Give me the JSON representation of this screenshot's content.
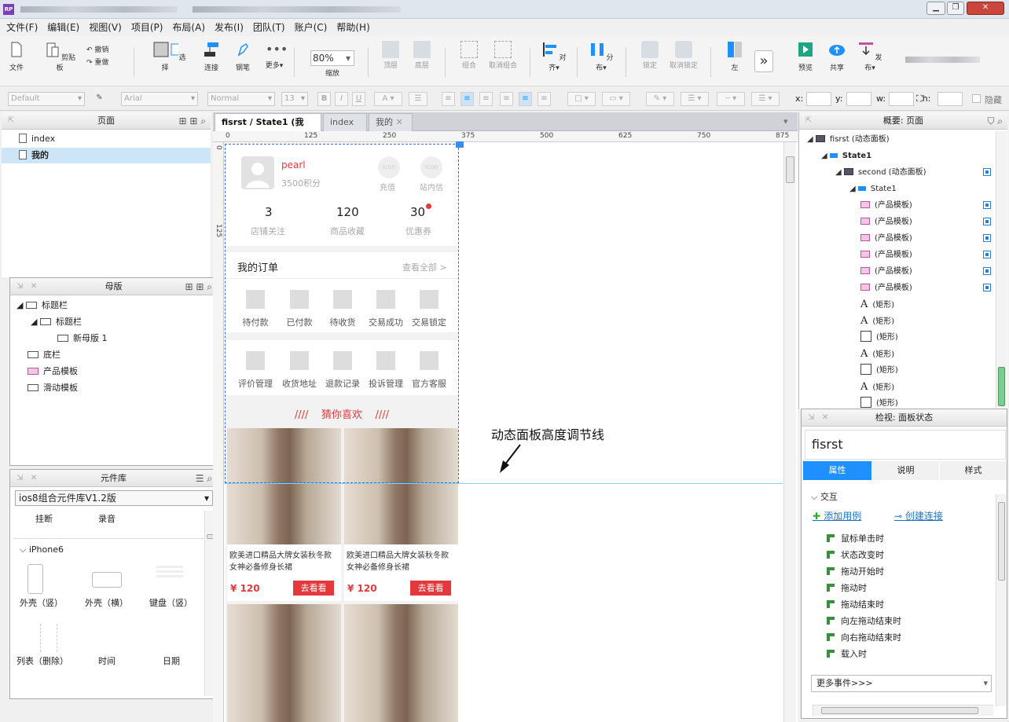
{
  "menu": [
    "文件(F)",
    "编辑(E)",
    "视图(V)",
    "项目(P)",
    "布局(A)",
    "发布(I)",
    "团队(T)",
    "账户(C)",
    "帮助(H)"
  ],
  "toolbar": {
    "file": "文件",
    "clipboard": "剪贴板",
    "undo": "撤销",
    "redo": "重做",
    "select": "选择",
    "connect": "连接",
    "pen": "钢笔",
    "more": "更多▾",
    "zoom": "80%",
    "zoom_label": "缩放",
    "top": "顶层",
    "bottom": "底层",
    "group": "组合",
    "ungroup": "取消组合",
    "align": "对齐▾",
    "distribute": "分布▾",
    "lock": "锁定",
    "unlock": "取消锁定",
    "left": "左",
    "preview": "预览",
    "share": "共享",
    "publish": "发布▾"
  },
  "fmt": {
    "style": "Default",
    "font": "Arial",
    "weight": "Normal",
    "size": "13",
    "x": "x:",
    "y": "y:",
    "w": "w:",
    "h": "h:",
    "hide": "隐藏"
  },
  "pages": {
    "title": "页面",
    "items": [
      "index",
      "我的"
    ]
  },
  "masters": {
    "title": "母版",
    "items": [
      "标题栏",
      "标题栏",
      "新母版 1",
      "底栏",
      "产品模板",
      "滑动模板"
    ]
  },
  "library": {
    "title": "元件库",
    "selected": "ios8组合元件库V1.2版",
    "top_items": [
      "挂断",
      "录音"
    ],
    "group": "iPhone6",
    "items": [
      "外壳（竖）",
      "外壳（横）",
      "键盘（竖）",
      "列表（删除）",
      "时间",
      "日期"
    ]
  },
  "tabs": [
    "fisrst / State1 (我的)",
    "index",
    "我的"
  ],
  "ruler": {
    "h": [
      "0",
      "125",
      "250",
      "375",
      "500",
      "625",
      "750",
      "875"
    ],
    "v": [
      "0",
      "125"
    ]
  },
  "phone": {
    "user": "pearl",
    "points": "3500积分",
    "icon_txt": "icon",
    "top_actions": [
      "充值",
      "站内信"
    ],
    "stats": [
      {
        "n": "3",
        "l": "店铺关注"
      },
      {
        "n": "120",
        "l": "商品收藏"
      },
      {
        "n": "30",
        "l": "优惠券"
      }
    ],
    "orders_title": "我的订单",
    "view_all": "查看全部 >",
    "order_items": [
      "待付款",
      "已付款",
      "待收货",
      "交易成功",
      "交易锁定"
    ],
    "service_items": [
      "评价管理",
      "收货地址",
      "退款记录",
      "投诉管理",
      "官方客服"
    ],
    "guess_prefix": "////",
    "guess": "猜你喜欢",
    "guess_suffix": "////",
    "product_desc": "欧美进口精品大牌女装秋冬款女神必备修身长裙",
    "price": "¥ 120",
    "buy": "去看看"
  },
  "annotation": "动态面板高度调节线",
  "outline": {
    "title": "概要: 页面",
    "rows": [
      {
        "t": "fisrst (动态面板)",
        "ic": "dp"
      },
      {
        "t": "State1",
        "ic": "st"
      },
      {
        "t": "second (动态面板)",
        "ic": "dp"
      },
      {
        "t": "State1",
        "ic": "st"
      },
      {
        "t": "(产品模板)",
        "ic": "pink"
      },
      {
        "t": "(产品模板)",
        "ic": "pink"
      },
      {
        "t": "(产品模板)",
        "ic": "pink"
      },
      {
        "t": "(产品模板)",
        "ic": "pink"
      },
      {
        "t": "(产品模板)",
        "ic": "pink"
      },
      {
        "t": "(产品模板)",
        "ic": "pink"
      },
      {
        "t": "(矩形)",
        "ic": "A"
      },
      {
        "t": "(矩形)",
        "ic": "A"
      },
      {
        "t": "(矩形)",
        "ic": "box"
      },
      {
        "t": "(矩形)",
        "ic": "A"
      },
      {
        "t": "(矩形)",
        "ic": "box"
      },
      {
        "t": "(矩形)",
        "ic": "A"
      },
      {
        "t": "(矩形)",
        "ic": "box"
      }
    ]
  },
  "inspect": {
    "title": "检视: 面板状态",
    "name": "fisrst",
    "tabs": [
      "属性",
      "说明",
      "样式"
    ],
    "section": "交互",
    "add_case": "添加用例",
    "create_link": "创建连接",
    "events": [
      "鼠标单击时",
      "状态改变时",
      "拖动开始时",
      "拖动时",
      "拖动结束时",
      "向左拖动结束时",
      "向右拖动结束时",
      "载入时"
    ],
    "more": "更多事件>>>"
  },
  "colors": {
    "accent": "#1e90ff",
    "red": "#e4393c"
  }
}
